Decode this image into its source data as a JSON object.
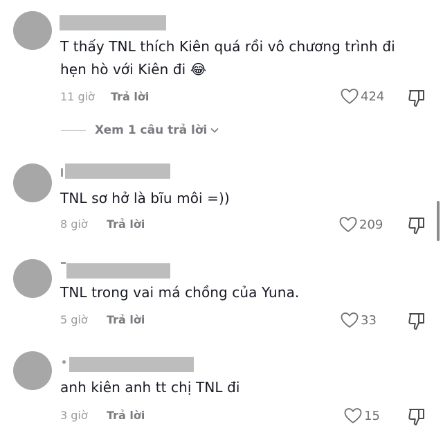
{
  "comments": [
    {
      "text_line1": "T thấy TNL thích Kiên quá rồi vô chương trình đi",
      "text_line2": "hẹn hò với Kiên đi",
      "emoji": "😂",
      "time": "11 giờ",
      "reply_label": "Trả lời",
      "likes": "424"
    },
    {
      "text_line1": "TNL sơ hở là bĩu môi =))",
      "time": "8 giờ",
      "reply_label": "Trả lời",
      "likes": "209"
    },
    {
      "text_line1": "TNL trong vai má chồng của Yuna.",
      "time": "5 giờ",
      "reply_label": "Trả lời",
      "likes": "33"
    },
    {
      "text_line1": "anh kiên anh tt chị TNL đi",
      "time": "3 giờ",
      "reply_label": "Trả lời",
      "likes": "15"
    }
  ],
  "view_replies_label": "Xem 1 câu trả lời",
  "icons": {
    "like": "heart-outline-icon",
    "dislike": "thumbs-down-outline-icon",
    "expand": "chevron-down-icon"
  },
  "colors": {
    "text": "#161823",
    "muted": "#9a9aa0",
    "avatar_placeholder": "#a7a7a7",
    "name_redaction": "#bdbdbd"
  }
}
